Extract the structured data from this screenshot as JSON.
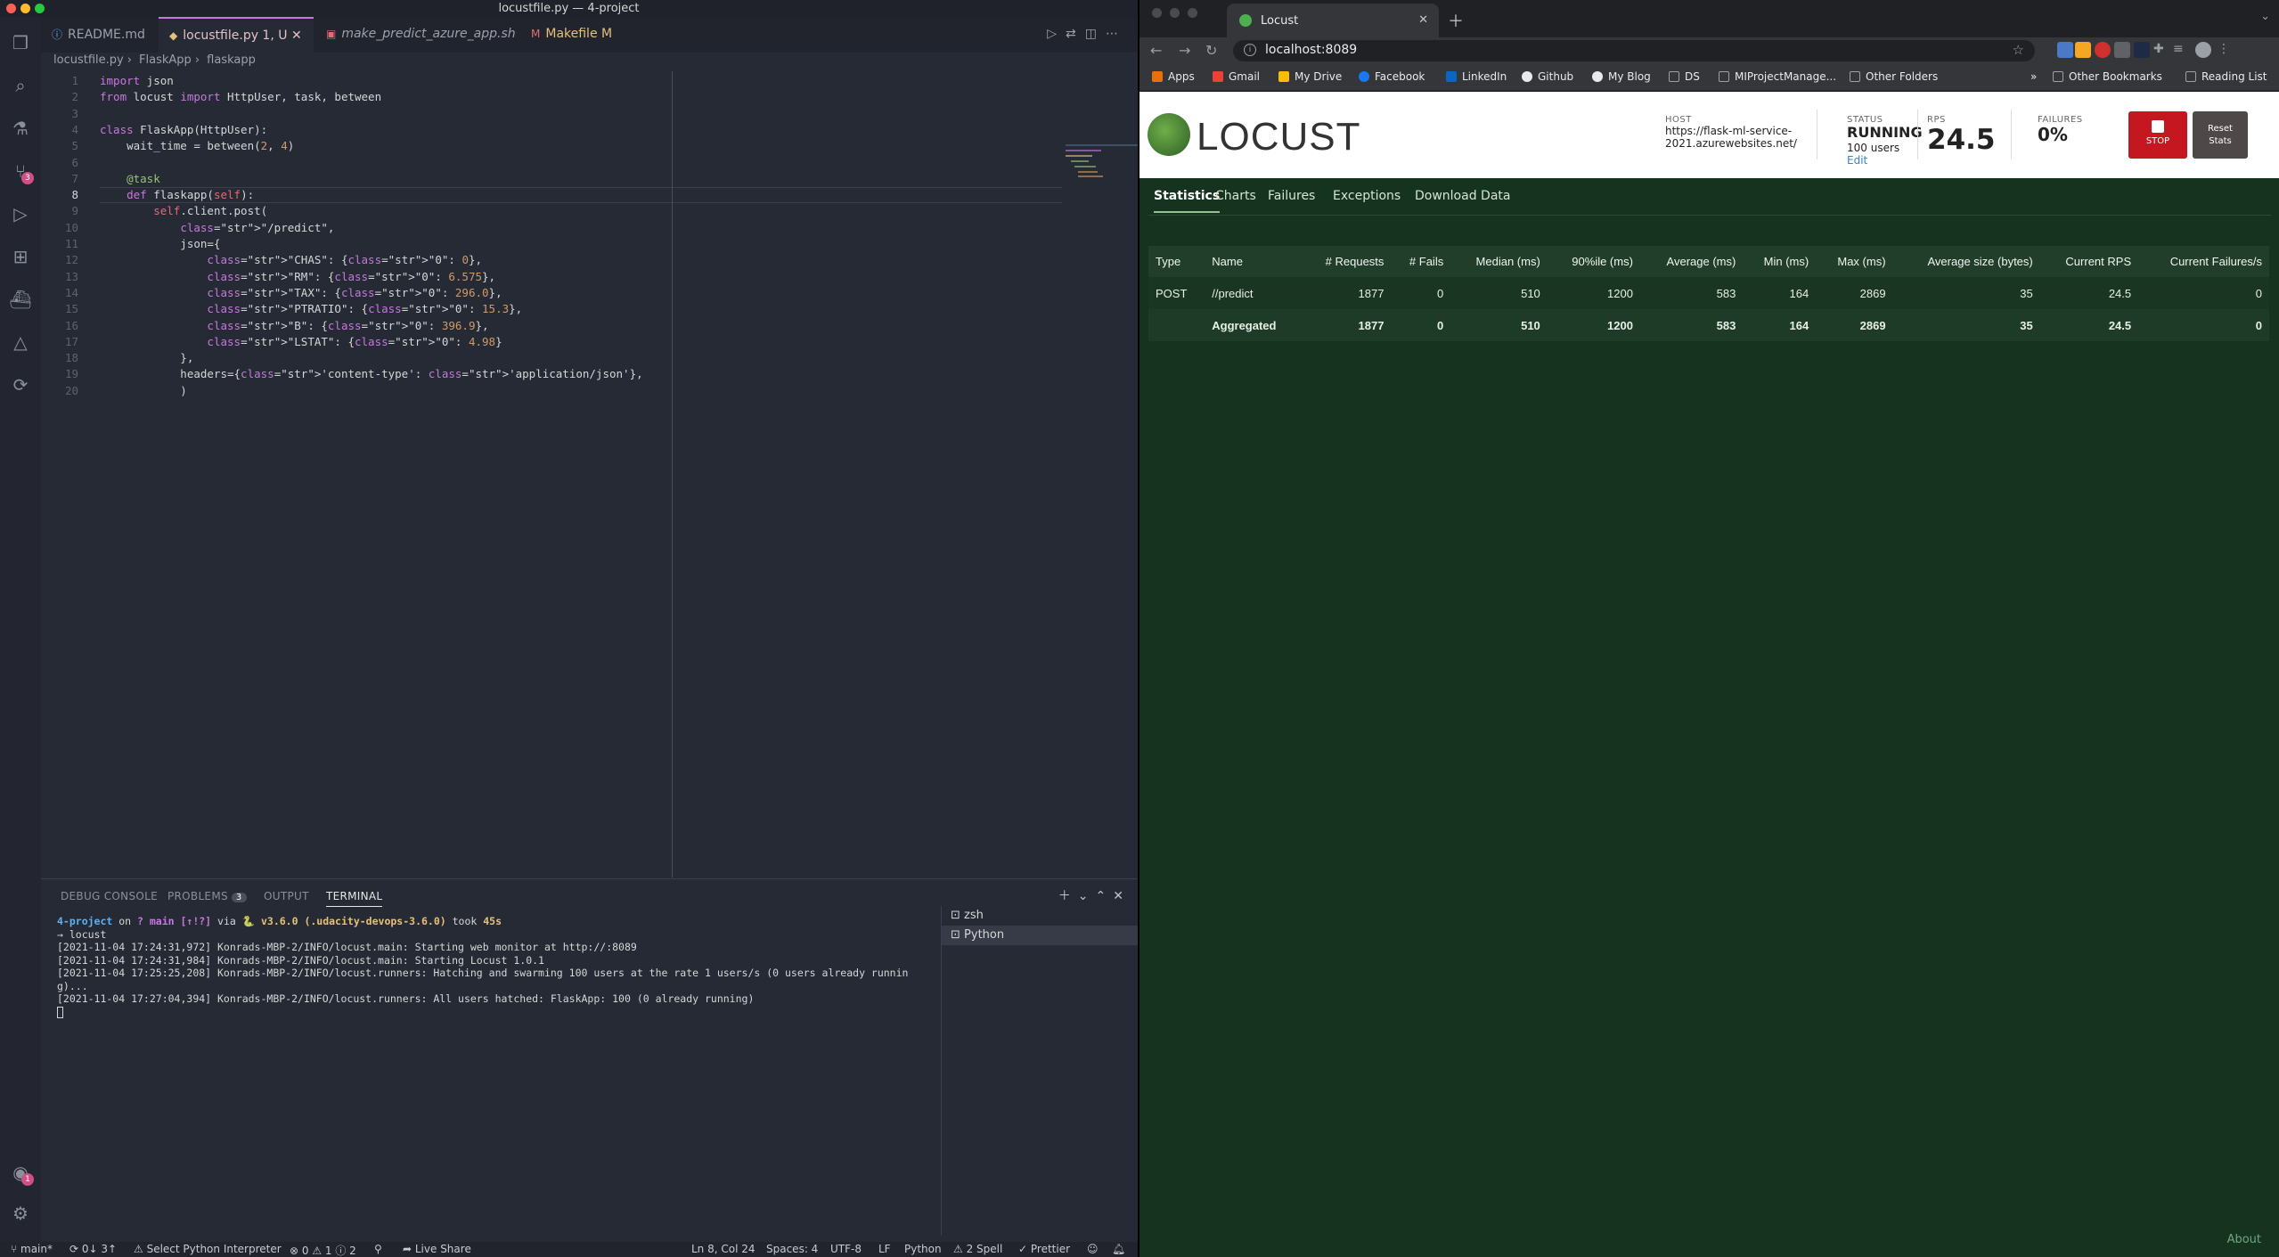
{
  "vscode": {
    "window_title": "locustfile.py — 4-project",
    "tabs": [
      {
        "label": "README.md",
        "icon": "info-icon",
        "color": "#61afef"
      },
      {
        "label": "locustfile.py  1, U",
        "icon": "python-icon",
        "color": "#e3c1c6"
      },
      {
        "label": "make_predict_azure_app.sh",
        "icon": "shell-icon",
        "color": "#e06c75"
      },
      {
        "label": "Makefile  M",
        "icon": "makefile-icon",
        "color": "#e5c07b"
      }
    ],
    "breadcrumb": [
      "locustfile.py",
      "FlaskApp",
      "flaskapp"
    ],
    "line_numbers": [
      "1",
      "2",
      "3",
      "4",
      "5",
      "6",
      "7",
      "8",
      "9",
      "10",
      "11",
      "12",
      "13",
      "14",
      "15",
      "16",
      "17",
      "18",
      "19",
      "20"
    ],
    "code": [
      "import json",
      "from locust import HttpUser, task, between",
      "",
      "class FlaskApp(HttpUser):",
      "    wait_time = between(2, 4)",
      "",
      "    @task",
      "    def flaskapp(self):",
      "        self.client.post(",
      "            \"/predict\",",
      "            json={",
      "                \"CHAS\": {\"0\": 0},",
      "                \"RM\": {\"0\": 6.575},",
      "                \"TAX\": {\"0\": 296.0},",
      "                \"PTRATIO\": {\"0\": 15.3},",
      "                \"B\": {\"0\": 396.9},",
      "                \"LSTAT\": {\"0\": 4.98}",
      "            },",
      "            headers={'content-type': 'application/json'},",
      "            )"
    ],
    "panel": {
      "tabs": [
        "DEBUG CONSOLE",
        "PROBLEMS",
        "OUTPUT",
        "TERMINAL"
      ],
      "problems_count": "3",
      "terminal_prompt": {
        "project": "4-project",
        "on": " on ",
        "branch": "? main [↑!?]",
        "via": " via ",
        "python": "🐍 v3.6.0 (.udacity-devops-3.6.0)",
        "took_label": " took ",
        "took": "45s"
      },
      "terminal_lines": [
        "→ locust",
        "[2021-11-04 17:24:31,972] Konrads-MBP-2/INFO/locust.main: Starting web monitor at http://:8089",
        "[2021-11-04 17:24:31,984] Konrads-MBP-2/INFO/locust.main: Starting Locust 1.0.1",
        "[2021-11-04 17:25:25,208] Konrads-MBP-2/INFO/locust.runners: Hatching and swarming 100 users at the rate 1 users/s (0 users already runnin",
        "g)...",
        "[2021-11-04 17:27:04,394] Konrads-MBP-2/INFO/locust.runners: All users hatched: FlaskApp: 100 (0 already running)"
      ],
      "terminals": [
        "zsh",
        "Python"
      ]
    },
    "statusbar": {
      "branch": "main*",
      "sync": "0↓ 3↑",
      "interpreter": "Select Python Interpreter",
      "errors": "⊗ 0 ⚠ 1 ⓘ 2",
      "live_share": "Live Share",
      "position": "Ln 8, Col 24",
      "spaces": "Spaces: 4",
      "encoding": "UTF-8",
      "eol": "LF",
      "language": "Python",
      "spell": "⚠ 2 Spell",
      "prettier": "✓ Prettier"
    }
  },
  "chrome": {
    "tab_title": "Locust",
    "url": "localhost:8089",
    "bookmarks": [
      "Apps",
      "Gmail",
      "My Drive",
      "Facebook",
      "LinkedIn",
      "Github",
      "My Blog",
      "DS",
      "MIProjectManage...",
      "Other Folders",
      "»",
      "Other Bookmarks",
      "Reading List"
    ]
  },
  "locust": {
    "logo": "LOCUST",
    "host_label": "HOST",
    "host_value": "https://flask-ml-service-2021.azurewebsites.net/",
    "status_label": "STATUS",
    "status_value": "RUNNING",
    "users": "100 users",
    "edit": "Edit",
    "rps_label": "RPS",
    "rps_value": "24.5",
    "failures_label": "FAILURES",
    "failures_value": "0%",
    "stop": "STOP",
    "reset_stats": "Reset Stats",
    "nav": [
      "Statistics",
      "Charts",
      "Failures",
      "Exceptions",
      "Download Data"
    ],
    "table": {
      "headers": [
        "Type",
        "Name",
        "# Requests",
        "# Fails",
        "Median (ms)",
        "90%ile (ms)",
        "Average (ms)",
        "Min (ms)",
        "Max (ms)",
        "Average size (bytes)",
        "Current RPS",
        "Current Failures/s"
      ],
      "rows": [
        [
          "POST",
          "//predict",
          "1877",
          "0",
          "510",
          "1200",
          "583",
          "164",
          "2869",
          "35",
          "24.5",
          "0"
        ],
        [
          "",
          "Aggregated",
          "1877",
          "0",
          "510",
          "1200",
          "583",
          "164",
          "2869",
          "35",
          "24.5",
          "0"
        ]
      ]
    },
    "about": "About"
  }
}
